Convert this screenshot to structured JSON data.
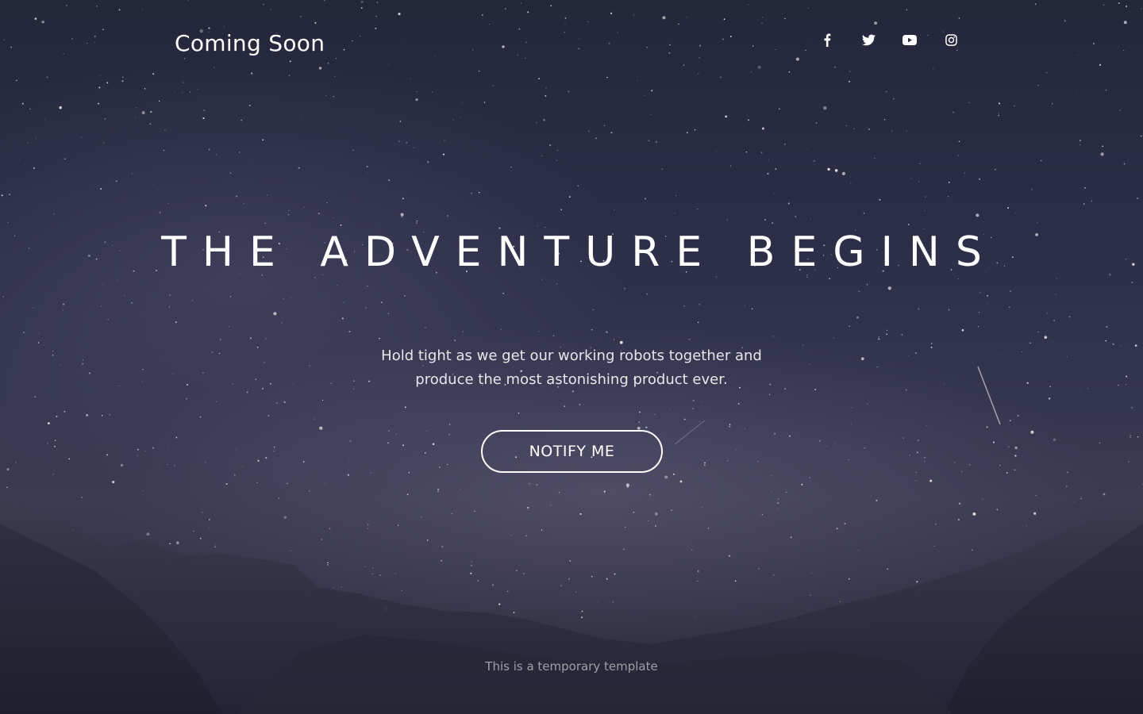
{
  "header": {
    "brand": "Coming Soon",
    "social": [
      {
        "name": "facebook-icon"
      },
      {
        "name": "twitter-icon"
      },
      {
        "name": "youtube-icon"
      },
      {
        "name": "instagram-icon"
      }
    ]
  },
  "hero": {
    "title": "THE ADVENTURE BEGINS",
    "subtitle_line1": "Hold tight as we get our working robots together and",
    "subtitle_line2": "produce the most astonishing product ever.",
    "button_label": "NOTIFY ME"
  },
  "footer": {
    "text": "This is a temporary template"
  },
  "colors": {
    "text": "#ffffff",
    "sky_top": "#24273a",
    "sky_mid": "#34354f",
    "mountain": "#23243a"
  }
}
